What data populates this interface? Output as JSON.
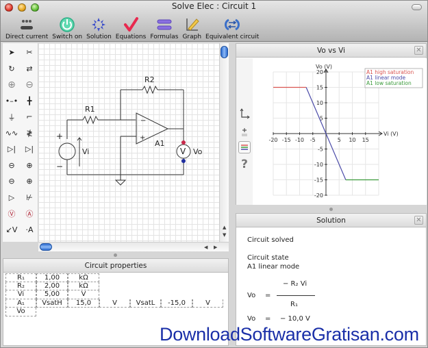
{
  "window": {
    "title": "Solve Elec : Circuit 1"
  },
  "toolbar": {
    "items": [
      {
        "label": "Direct current",
        "icon": "direct-current-icon"
      },
      {
        "label": "Switch on",
        "icon": "power-icon"
      },
      {
        "label": "Solution",
        "icon": "solution-icon"
      },
      {
        "label": "Equations",
        "icon": "checkmark-icon"
      },
      {
        "label": "Formulas",
        "icon": "equals-icon"
      },
      {
        "label": "Graph",
        "icon": "graph-pen-icon"
      },
      {
        "label": "Equivalent circuit",
        "icon": "equivalent-circuit-icon"
      }
    ]
  },
  "palette": {
    "tools": [
      "select-arrow-icon",
      "cut-wire-icon",
      "rotate-icon",
      "swap-icon",
      "zoom-in-icon",
      "zoom-out-icon",
      "wire-icon",
      "node-icon",
      "ground-icon",
      "switch-icon",
      "resistor-icon",
      "variable-resistor-icon",
      "diode-icon",
      "led-icon",
      "voltage-source-icon",
      "current-source-icon",
      "controlled-voltage-source-icon",
      "controlled-current-source-icon",
      "op-amp-icon",
      "transistor-icon",
      "voltmeter-icon",
      "ammeter-icon",
      "voltage-arrow-icon",
      "current-arrow-icon"
    ],
    "labels": {
      "voltmeter": "V",
      "ammeter": "A",
      "voltage_arrow": "V",
      "current_arrow": "A"
    }
  },
  "circuit": {
    "labels": {
      "r1": "R1",
      "r2": "R2",
      "vi": "Vi",
      "a1": "A1",
      "vo": "Vo",
      "meter": "V",
      "plus": "+",
      "minus": "−",
      "opamp_minus": "−",
      "opamp_plus": "+"
    }
  },
  "properties": {
    "title": "Circuit properties",
    "rows": [
      [
        "R₁",
        "1,00",
        "kΩ"
      ],
      [
        "R₂",
        "2,00",
        "kΩ"
      ],
      [
        "Vi",
        "5,00",
        "V"
      ],
      [
        "A₁",
        "VsatH",
        "15,0",
        "V",
        "VsatL",
        "-15,0",
        "V"
      ],
      [
        "Vo"
      ]
    ]
  },
  "graph_panel": {
    "title": "Vo vs Vi",
    "tools": [
      "axes-icon",
      "add-curve-icon",
      "legend-icon",
      "help-icon"
    ],
    "help_label": "?"
  },
  "chart_data": {
    "type": "line",
    "title": "Vo vs Vi",
    "xlabel": "Vi (V)",
    "ylabel": "Vo (V)",
    "xlim": [
      -20,
      20
    ],
    "ylim": [
      -20,
      20
    ],
    "xticks": [
      -20,
      -15,
      -10,
      -5,
      5,
      10,
      15
    ],
    "yticks": [
      -20,
      -15,
      -10,
      -5,
      5,
      10,
      15,
      20
    ],
    "grid": true,
    "legend": "top-right",
    "series": [
      {
        "name": "A1 high saturation",
        "color": "#d9534f",
        "points": [
          [
            -20,
            15
          ],
          [
            -7.5,
            15
          ]
        ]
      },
      {
        "name": "A1 linear mode",
        "color": "#4a4aa8",
        "points": [
          [
            -7.5,
            15
          ],
          [
            7.5,
            -15
          ]
        ]
      },
      {
        "name": "A1 low saturation",
        "color": "#3a9a3a",
        "points": [
          [
            7.5,
            -15
          ],
          [
            20,
            -15
          ]
        ]
      }
    ]
  },
  "solution": {
    "title": "Solution",
    "status": "Circuit solved",
    "state_label": "Circuit state",
    "state_value": "A1 linear mode",
    "eq1_lhs": "Vo",
    "eq1_eq": "=",
    "eq1_num": "− R₂ Vi",
    "eq1_den": "R₁",
    "eq2_lhs": "Vo",
    "eq2_eq": "=",
    "eq2_rhs": "− 10,0 V"
  },
  "watermark": "DownloadSoftwareGratisan.com"
}
